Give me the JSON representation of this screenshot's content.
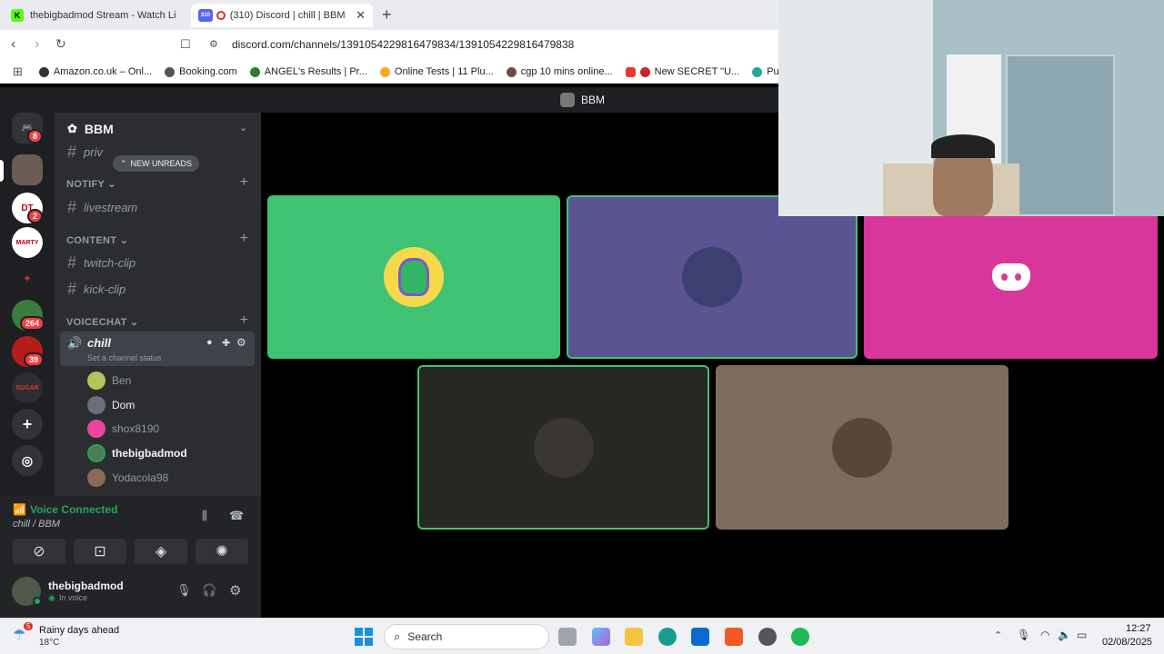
{
  "browser": {
    "tabs": [
      {
        "favicon": "K",
        "title": "thebigbadmod Stream - Watch Live",
        "active": false
      },
      {
        "favicon": "310",
        "title": "(310) Discord | chill | BBM",
        "active": true
      }
    ],
    "url": "discord.com/channels/1391054229816479834/1391054229816479838",
    "bookmarks": [
      "Amazon.co.uk – Onl...",
      "Booking.com",
      "ANGEL's Results | Pr...",
      "Online Tests | 11 Plu...",
      "cgp 10 mins online...",
      "New SECRET \"U...",
      "Publish"
    ]
  },
  "discord": {
    "top_title": "BBM",
    "server_name": "BBM",
    "new_unreads": "NEW UNREADS",
    "partial_channel": "priv",
    "categories": [
      {
        "name": "NOTIFY",
        "channels": [
          "livestream"
        ]
      },
      {
        "name": "CONTENT",
        "channels": [
          "twitch-clip",
          "kick-clip"
        ]
      },
      {
        "name": "VOICECHAT",
        "channels": [
          "chill"
        ]
      }
    ],
    "voice_channel_status": "Set a channel status",
    "members": [
      {
        "name": "Ben",
        "color": "#949ba4",
        "avatar": "#b6c35a"
      },
      {
        "name": "Dom",
        "color": "#f2f3f5",
        "avatar": "#6b6f7a"
      },
      {
        "name": "shox8190",
        "color": "#949ba4",
        "avatar": "#eb459e"
      },
      {
        "name": "thebigbadmod",
        "color": "#f2f3f5",
        "avatar": "#4f7a52"
      },
      {
        "name": "Yodacola98",
        "color": "#949ba4",
        "avatar": "#8a6a55"
      }
    ],
    "guild_badges": [
      "8",
      "2",
      "264",
      "39"
    ],
    "voice": {
      "status": "Voice Connected",
      "location": "chill / BBM"
    },
    "user": {
      "name": "thebigbadmod",
      "status": "In voice"
    },
    "tiles": [
      {
        "name": "green-avatar-tile",
        "bg": "#3fc372"
      },
      {
        "name": "purple-avatar-tile",
        "bg": "#5a5590"
      },
      {
        "name": "pink-discord-tile",
        "bg": "#d9369b"
      },
      {
        "name": "dark-avatar-tile",
        "bg": "#272824"
      },
      {
        "name": "brown-avatar-tile",
        "bg": "#7d6d5c"
      }
    ]
  },
  "taskbar": {
    "weather_badge": "5",
    "weather_title": "Rainy days ahead",
    "weather_temp": "18°C",
    "search": "Search",
    "time": "12:27",
    "date": "02/08/2025"
  }
}
